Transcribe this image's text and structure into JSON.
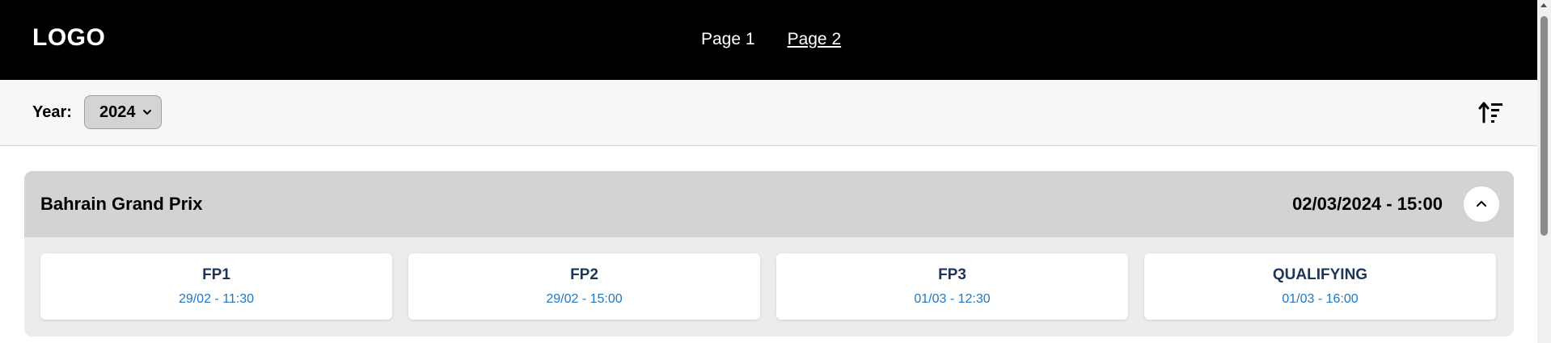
{
  "header": {
    "logo": "LOGO",
    "nav": [
      "Page 1",
      "Page 2"
    ]
  },
  "toolbar": {
    "year_label": "Year:",
    "year_value": "2024"
  },
  "race": {
    "name": "Bahrain Grand Prix",
    "datetime": "02/03/2024 - 15:00",
    "sessions": [
      {
        "name": "FP1",
        "time": "29/02 - 11:30"
      },
      {
        "name": "FP2",
        "time": "29/02 - 15:00"
      },
      {
        "name": "FP3",
        "time": "01/03 - 12:30"
      },
      {
        "name": "QUALIFYING",
        "time": "01/03 - 16:00"
      }
    ]
  },
  "icons": {
    "sort": "sort-ascending-icon",
    "collapse": "chevron-up-icon",
    "select": "chevron-down-icon"
  },
  "colors": {
    "header_bg": "#000000",
    "session_name": "#1d3557",
    "session_time": "#1f78c1"
  }
}
